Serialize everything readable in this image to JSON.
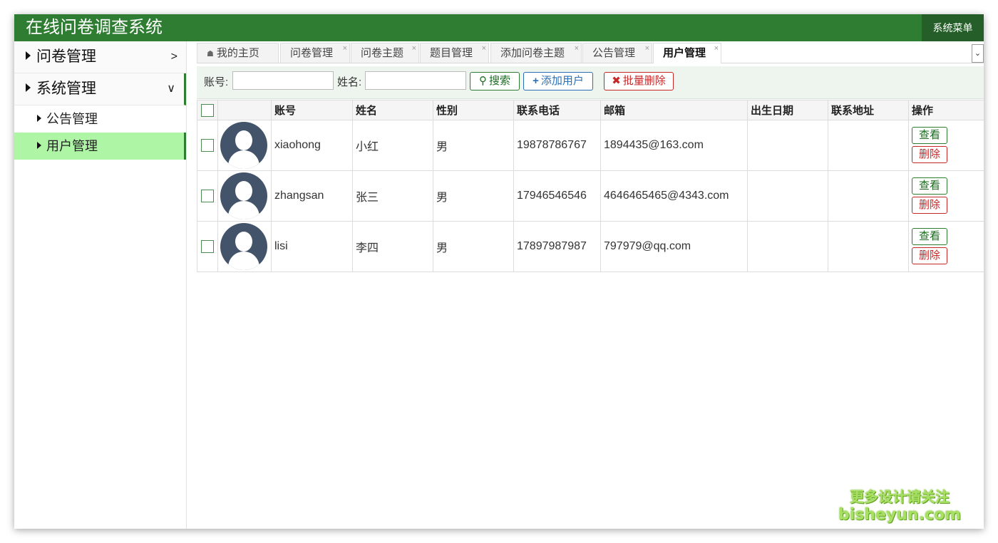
{
  "header": {
    "title": "在线问卷调查系统",
    "menu_button": "系统菜单"
  },
  "sidebar": {
    "groups": [
      {
        "label": "问卷管理",
        "chevron": ">"
      },
      {
        "label": "系统管理",
        "chevron": "∨"
      }
    ],
    "items": [
      {
        "label": "公告管理"
      },
      {
        "label": "用户管理"
      }
    ]
  },
  "tabs": [
    {
      "label": "我的主页",
      "icon": "home-icon"
    },
    {
      "label": "问卷管理"
    },
    {
      "label": "问卷主题"
    },
    {
      "label": "题目管理"
    },
    {
      "label": "添加问卷主题"
    },
    {
      "label": "公告管理"
    },
    {
      "label": "用户管理",
      "active": true
    }
  ],
  "toolbar": {
    "account_label": "账号:",
    "account_value": "",
    "name_label": "姓名:",
    "name_value": "",
    "search_label": "搜索",
    "add_label": "添加用户",
    "batch_delete_label": "批量删除"
  },
  "table": {
    "headers": [
      "账号",
      "姓名",
      "性别",
      "联系电话",
      "邮箱",
      "出生日期",
      "联系地址",
      "操作"
    ],
    "rows": [
      {
        "account": "xiaohong",
        "name": "小红",
        "gender": "男",
        "phone": "19878786767",
        "email": "1894435@163.com",
        "birth": "",
        "address": ""
      },
      {
        "account": "zhangsan",
        "name": "张三",
        "gender": "男",
        "phone": "17946546546",
        "email": "4646465465@4343.com",
        "birth": "",
        "address": ""
      },
      {
        "account": "lisi",
        "name": "李四",
        "gender": "男",
        "phone": "17897987987",
        "email": "797979@qq.com",
        "birth": "",
        "address": ""
      }
    ],
    "view_label": "查看",
    "delete_label": "删除"
  },
  "watermark": {
    "line1": "更多设计请关注",
    "line2": "bisheyun.com"
  },
  "colors": {
    "header_bg": "#2e7d32",
    "active_item_bg": "#aef5a6",
    "toolbar_bg": "#eef4ee"
  }
}
